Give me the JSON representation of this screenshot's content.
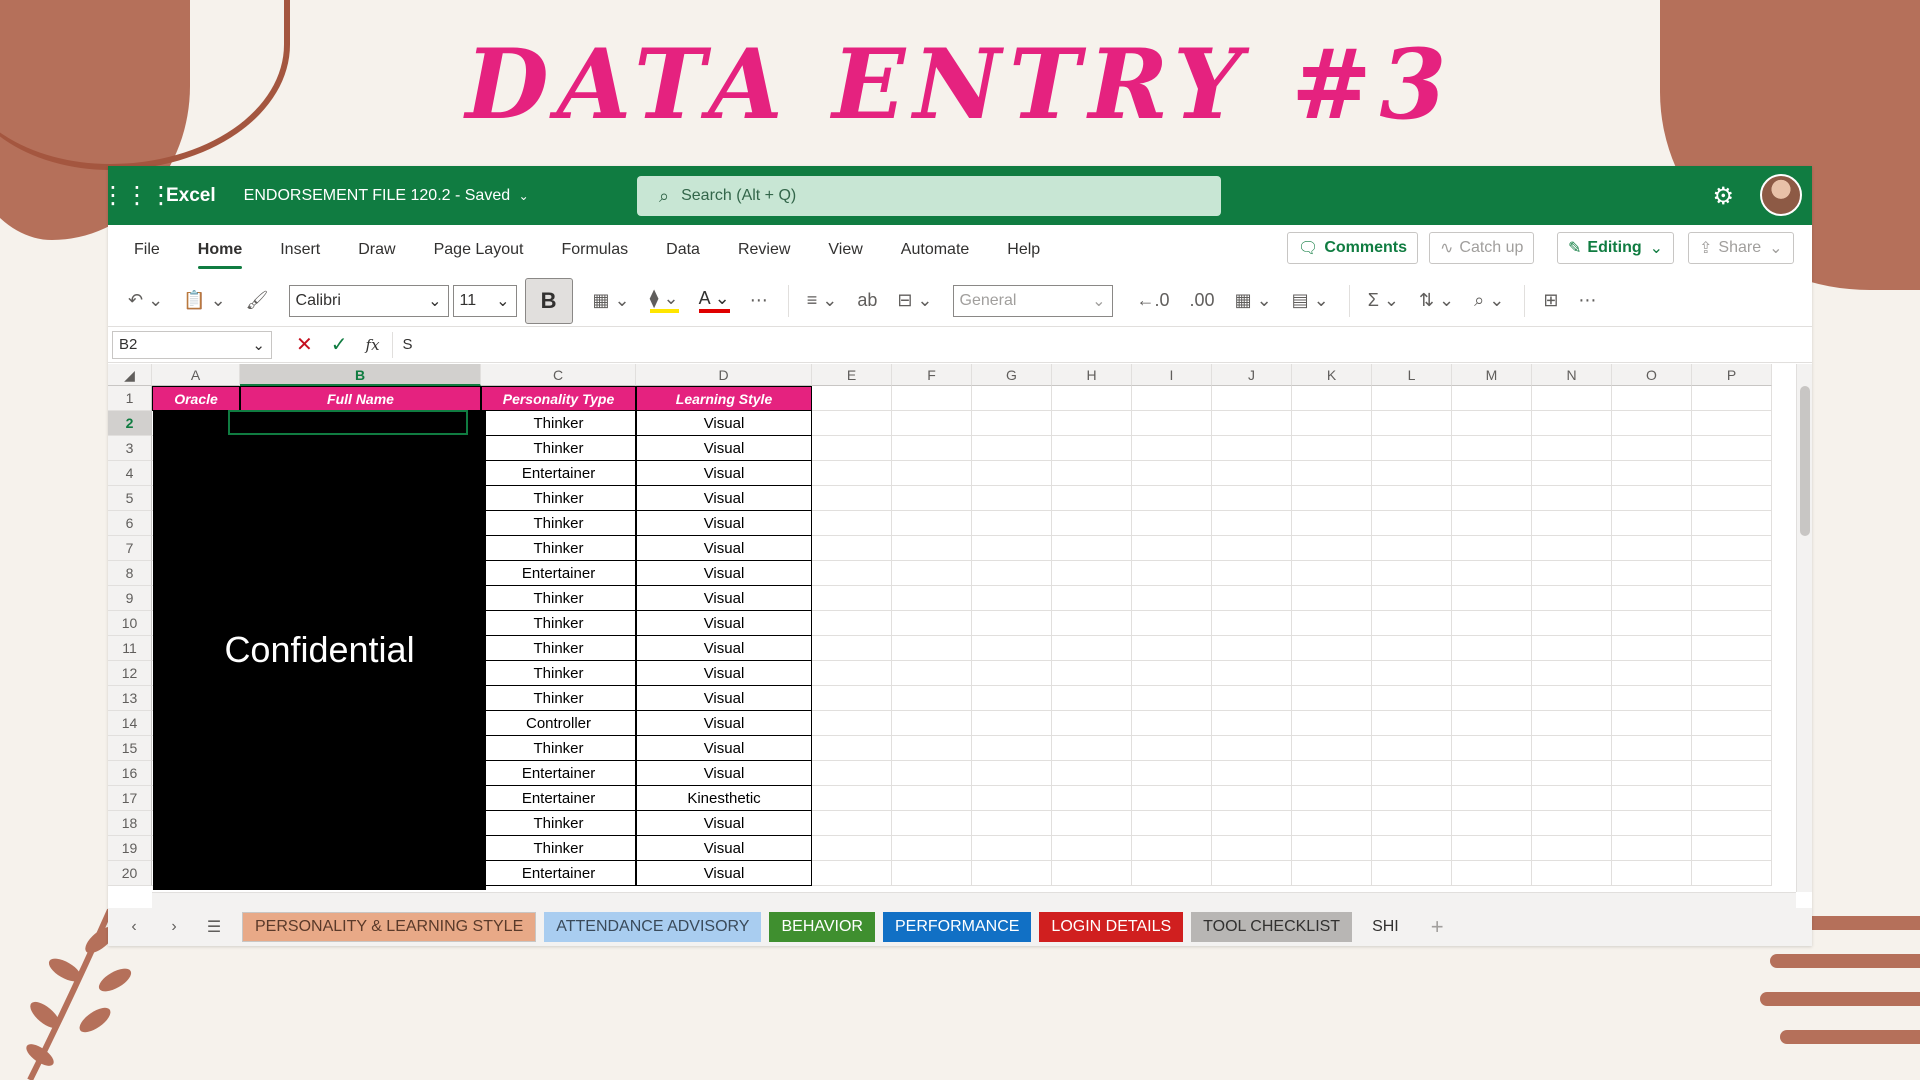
{
  "banner": {
    "title": "DATA ENTRY #3"
  },
  "titlebar": {
    "app_name": "Excel",
    "file_name": "ENDORSEMENT FILE 120.2  -  Saved",
    "search_placeholder": "Search (Alt + Q)"
  },
  "menu": {
    "items": [
      "File",
      "Home",
      "Insert",
      "Draw",
      "Page Layout",
      "Formulas",
      "Data",
      "Review",
      "View",
      "Automate",
      "Help"
    ],
    "active": "Home"
  },
  "actions": {
    "comments": "Comments",
    "catch_up": "Catch up",
    "editing": "Editing",
    "share": "Share"
  },
  "ribbon": {
    "font_name": "Calibri",
    "font_size": "11",
    "bold": "B",
    "number_format": "General"
  },
  "formula_bar": {
    "name_box": "B2",
    "formula": "S"
  },
  "grid": {
    "columns": [
      "A",
      "B",
      "C",
      "D",
      "E",
      "F",
      "G",
      "H",
      "I",
      "J",
      "K",
      "L",
      "M",
      "N",
      "O",
      "P"
    ],
    "selected_column": "B",
    "selected_row": 2,
    "headers": {
      "oracle": "Oracle",
      "full_name": "Full Name",
      "personality_type": "Personality Type",
      "learning_style": "Learning Style"
    },
    "redaction_label": "Confidential",
    "rows": [
      {
        "num": "2",
        "personality": "Thinker",
        "learning": "Visual"
      },
      {
        "num": "3",
        "personality": "Thinker",
        "learning": "Visual"
      },
      {
        "num": "4",
        "personality": "Entertainer",
        "learning": "Visual"
      },
      {
        "num": "5",
        "personality": "Thinker",
        "learning": "Visual"
      },
      {
        "num": "6",
        "personality": "Thinker",
        "learning": "Visual"
      },
      {
        "num": "7",
        "personality": "Thinker",
        "learning": "Visual"
      },
      {
        "num": "8",
        "personality": "Entertainer",
        "learning": "Visual"
      },
      {
        "num": "9",
        "personality": "Thinker",
        "learning": "Visual"
      },
      {
        "num": "10",
        "personality": "Thinker",
        "learning": "Visual"
      },
      {
        "num": "11",
        "personality": "Thinker",
        "learning": "Visual"
      },
      {
        "num": "12",
        "personality": "Thinker",
        "learning": "Visual"
      },
      {
        "num": "13",
        "personality": "Thinker",
        "learning": "Visual"
      },
      {
        "num": "14",
        "personality": "Controller",
        "learning": "Visual"
      },
      {
        "num": "15",
        "personality": "Thinker",
        "learning": "Visual"
      },
      {
        "num": "16",
        "personality": "Entertainer",
        "learning": "Visual"
      },
      {
        "num": "17",
        "personality": "Entertainer",
        "learning": "Kinesthetic"
      },
      {
        "num": "18",
        "personality": "Thinker",
        "learning": "Visual"
      },
      {
        "num": "19",
        "personality": "Thinker",
        "learning": "Visual"
      },
      {
        "num": "20",
        "personality": "Entertainer",
        "learning": "Visual"
      }
    ]
  },
  "sheets": [
    {
      "label": "PERSONALITY & LEARNING STYLE",
      "bg": "#e8a987",
      "fg": "#5a3a2a"
    },
    {
      "label": "ATTENDANCE ADVISORY",
      "bg": "#a9cdf0",
      "fg": "#3a4a5a"
    },
    {
      "label": "BEHAVIOR",
      "bg": "#3f8f2f",
      "fg": "#ffffff"
    },
    {
      "label": "PERFORMANCE",
      "bg": "#1170c5",
      "fg": "#ffffff"
    },
    {
      "label": "LOGIN DETAILS",
      "bg": "#d01f1f",
      "fg": "#ffffff"
    },
    {
      "label": "TOOL CHECKLIST",
      "bg": "#b8b6b4",
      "fg": "#323130"
    },
    {
      "label": "SHI",
      "bg": "#f3f2f1",
      "fg": "#323130"
    }
  ],
  "colors": {
    "excel_green": "#107c41",
    "header_pink": "#e5227f",
    "title_pink": "#e5227f",
    "deco_brown": "#b5705a"
  }
}
